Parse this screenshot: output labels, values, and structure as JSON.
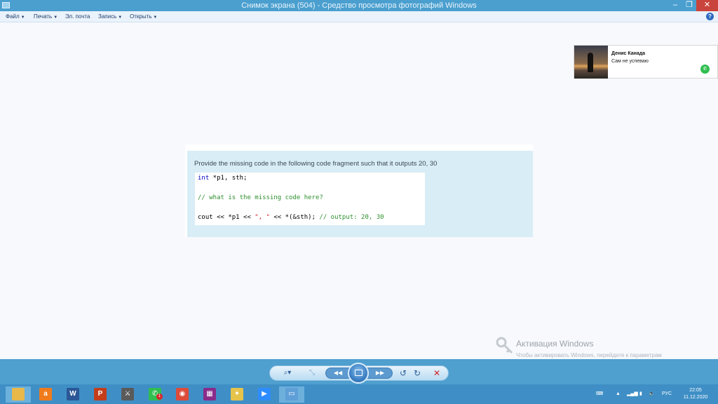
{
  "window": {
    "title": "Снимок экрана (504) - Средство просмотра фотографий Windows",
    "minimize_icon": "minimize-icon",
    "maximize_icon": "restore-icon",
    "close_icon": "close-icon"
  },
  "menu": {
    "items": [
      {
        "label": "Файл",
        "has_caret": true
      },
      {
        "label": "Печать",
        "has_caret": true
      },
      {
        "label": "Эл. почта",
        "has_caret": false
      },
      {
        "label": "Запись",
        "has_caret": true
      },
      {
        "label": "Открыть",
        "has_caret": true
      }
    ],
    "help_label": "?"
  },
  "notification": {
    "sender": "Денис Канада",
    "message": "Сам не успеваю",
    "app_icon": "whatsapp-icon"
  },
  "image_content": {
    "question": "Provide the missing code in the following code fragment such that it outputs 20, 30",
    "code": {
      "line1_keyword": "int",
      "line1_rest": " *p1, sth;",
      "line2_comment": "// what is the missing code here?",
      "line3_start": "cout << *p1 << ",
      "line3_string": "\", \"",
      "line3_mid": " << *(&sth); ",
      "line3_comment": "// output: 20, 30"
    }
  },
  "watermark": {
    "title": "Активация Windows",
    "subtitle": "Чтобы активировать Windows, перейдите к параметрам компьютера."
  },
  "viewer_toolbar": {
    "buttons": [
      "zoom-icon",
      "actual-size-icon",
      "previous-icon",
      "slideshow-icon",
      "next-icon",
      "rotate-left-icon",
      "rotate-right-icon",
      "delete-icon"
    ]
  },
  "taskbar": {
    "apps": [
      {
        "name": "file-explorer",
        "glyph": "",
        "color": "#e8b84a",
        "active": true
      },
      {
        "name": "avast",
        "glyph": "a",
        "color": "#f07b1c",
        "active": false
      },
      {
        "name": "word",
        "glyph": "W",
        "color": "#2b5797",
        "active": false
      },
      {
        "name": "powerpoint",
        "glyph": "P",
        "color": "#c43e1c",
        "active": false
      },
      {
        "name": "counter-strike",
        "glyph": "⚔",
        "color": "#5a5a5a",
        "active": false
      },
      {
        "name": "whatsapp",
        "glyph": "✆",
        "color": "#2fbe50",
        "active": false,
        "badge": "1"
      },
      {
        "name": "chrome",
        "glyph": "◉",
        "color": "#dd4b39",
        "active": false
      },
      {
        "name": "winrar",
        "glyph": "▦",
        "color": "#8a2b8a",
        "active": false
      },
      {
        "name": "photo-app",
        "glyph": "✦",
        "color": "#e6c34a",
        "active": false
      },
      {
        "name": "zoom",
        "glyph": "▶",
        "color": "#2d8cff",
        "active": false
      },
      {
        "name": "photo-viewer",
        "glyph": "▭",
        "color": "#5f9fd8",
        "active": true
      }
    ],
    "keyboard_icon": "keyboard-icon",
    "language": "РУС",
    "time": "22:05",
    "date": "11.12.2020"
  }
}
